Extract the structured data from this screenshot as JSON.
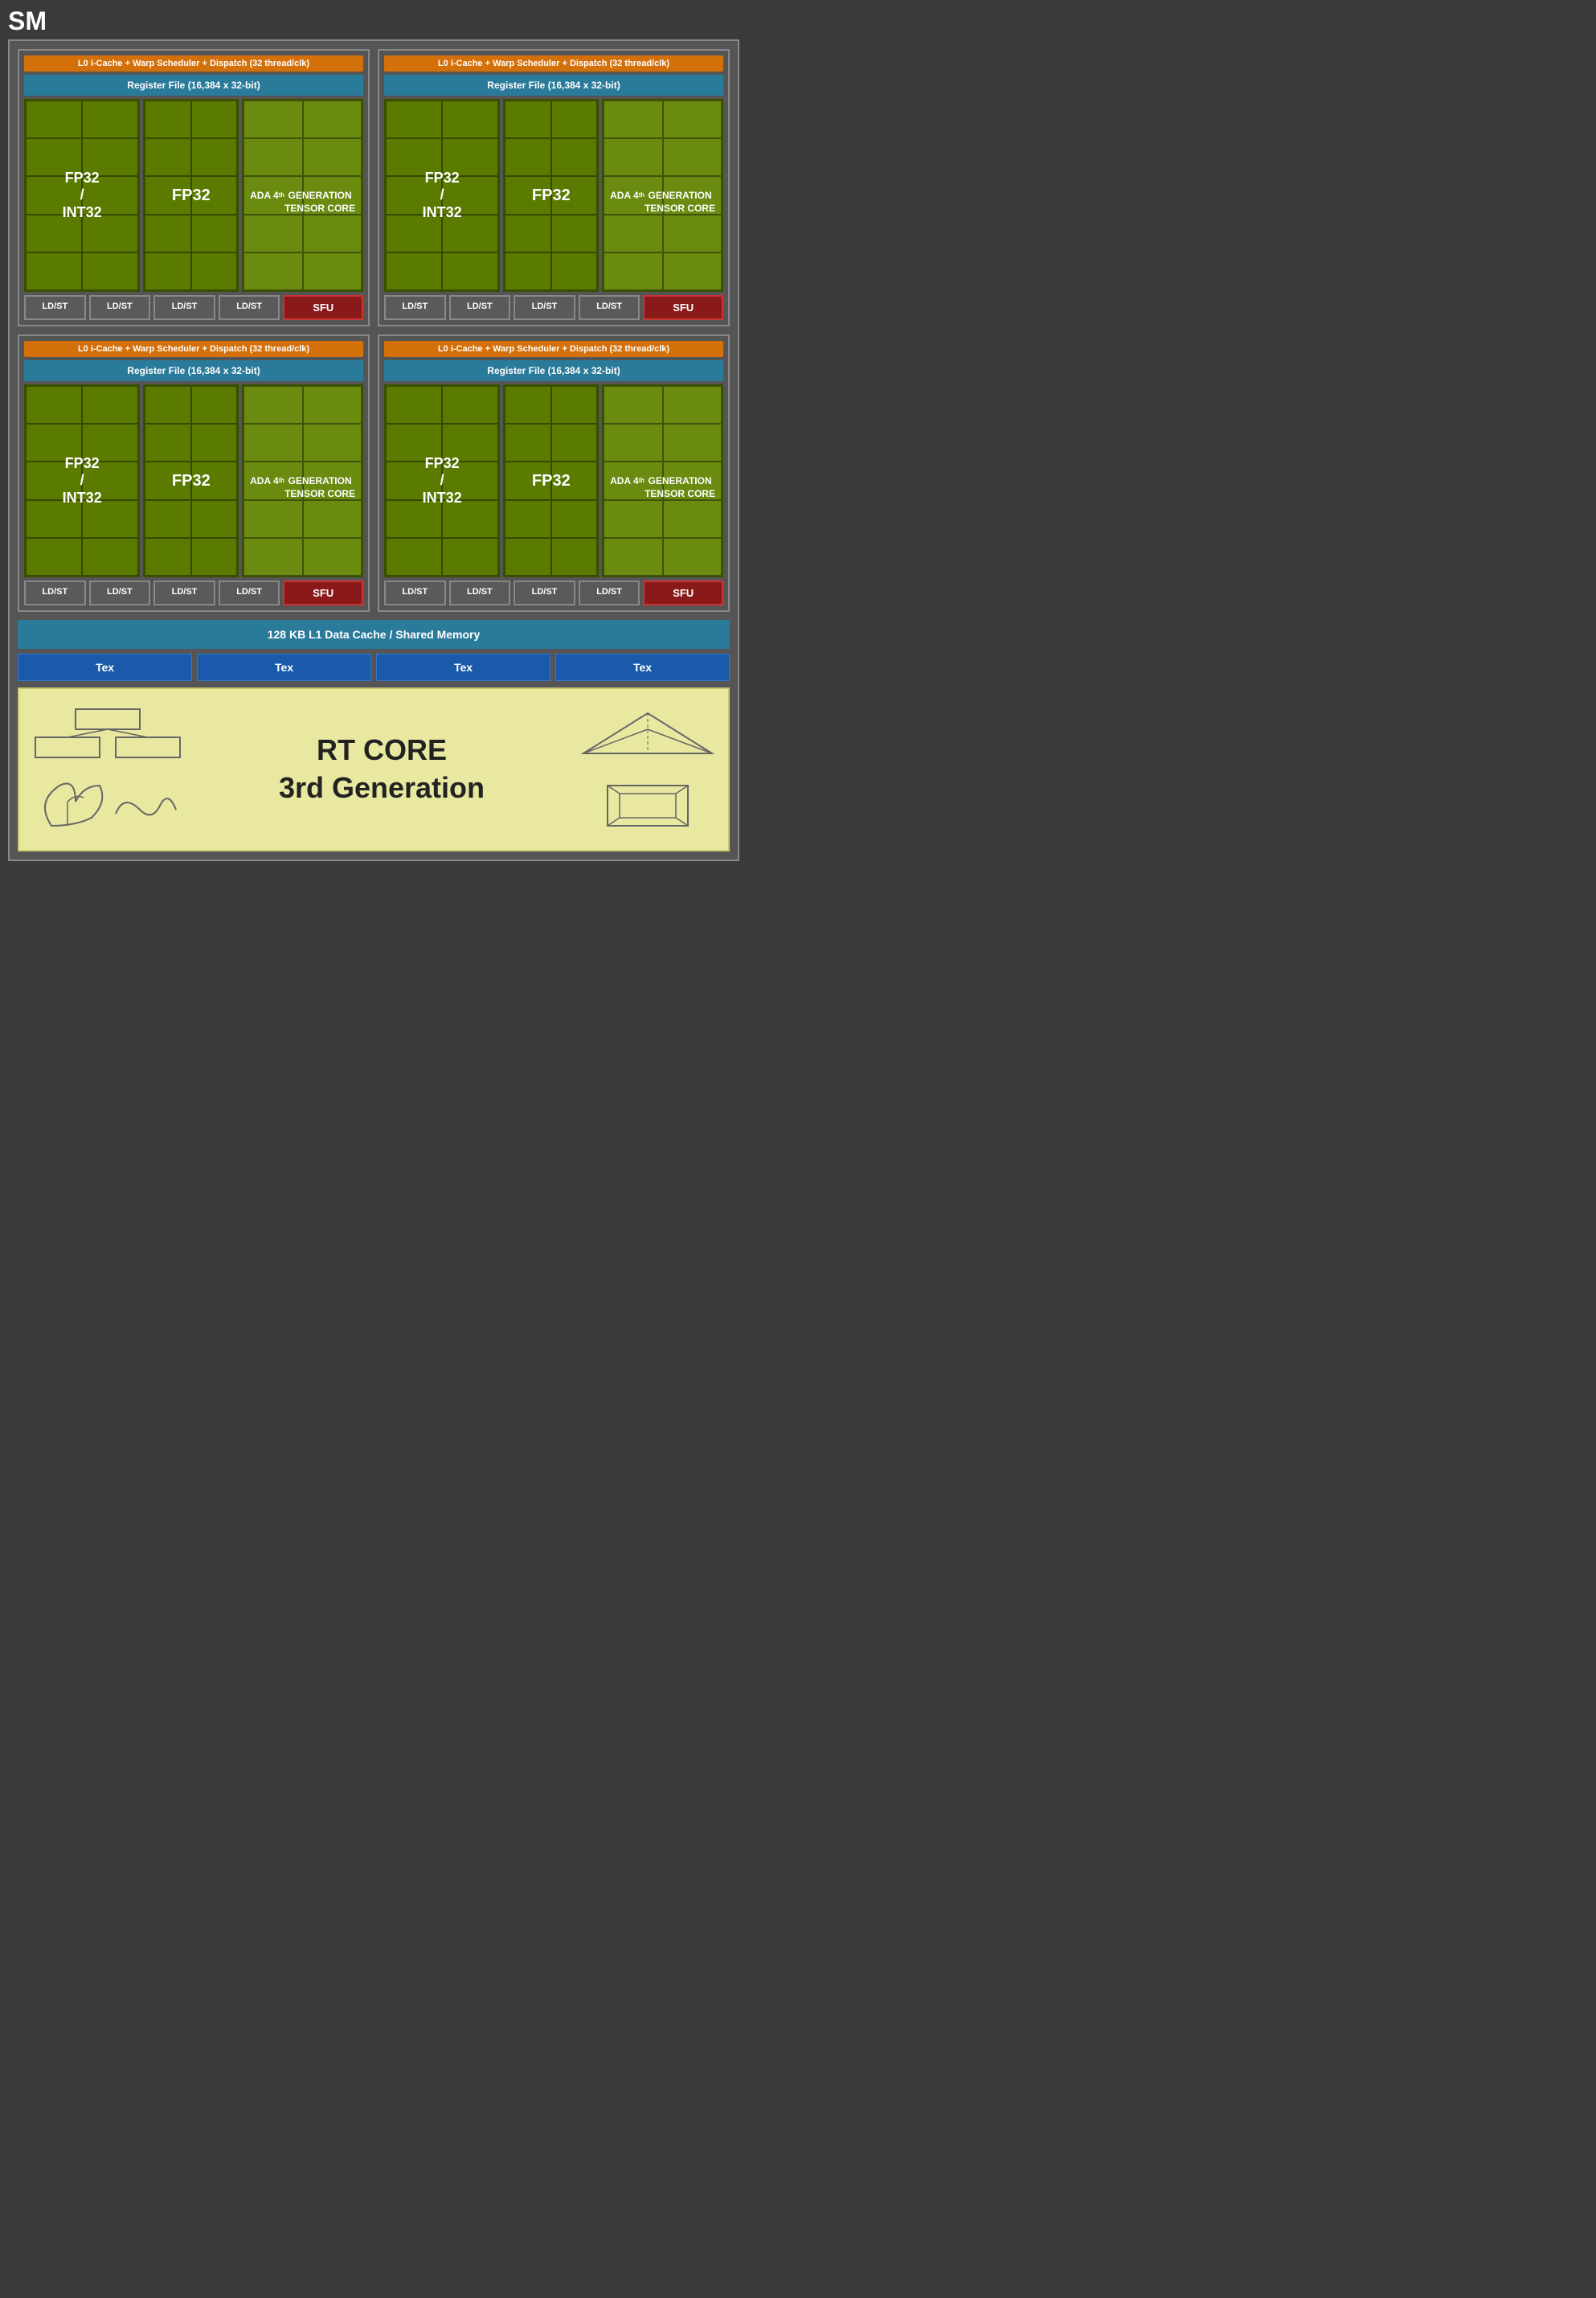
{
  "title": "SM",
  "quadrants": [
    {
      "id": "q1",
      "l0_header": "L0 i-Cache + Warp Scheduler + Dispatch (32 thread/clk)",
      "reg_file": "Register File (16,384 x 32-bit)",
      "fp32_int32_label": "FP32\n/\nINT32",
      "fp32_label": "FP32",
      "tensor_label": "ADA 4th\nGENERATION\nTENSOR CORE",
      "bottom": [
        "LD/ST",
        "LD/ST",
        "LD/ST",
        "LD/ST",
        "SFU"
      ]
    },
    {
      "id": "q2",
      "l0_header": "L0 i-Cache + Warp Scheduler + Dispatch (32 thread/clk)",
      "reg_file": "Register File (16,384 x 32-bit)",
      "fp32_int32_label": "FP32\n/\nINT32",
      "fp32_label": "FP32",
      "tensor_label": "ADA 4th\nGENERATION\nTENSOR CORE",
      "bottom": [
        "LD/ST",
        "LD/ST",
        "LD/ST",
        "LD/ST",
        "SFU"
      ]
    },
    {
      "id": "q3",
      "l0_header": "L0 i-Cache + Warp Scheduler + Dispatch (32 thread/clk)",
      "reg_file": "Register File (16,384 x 32-bit)",
      "fp32_int32_label": "FP32\n/\nINT32",
      "fp32_label": "FP32",
      "tensor_label": "ADA 4th\nGENERATION\nTENSOR CORE",
      "bottom": [
        "LD/ST",
        "LD/ST",
        "LD/ST",
        "LD/ST",
        "SFU"
      ]
    },
    {
      "id": "q4",
      "l0_header": "L0 i-Cache + Warp Scheduler + Dispatch (32 thread/clk)",
      "reg_file": "Register File (16,384 x 32-bit)",
      "fp32_int32_label": "FP32\n/\nINT32",
      "fp32_label": "FP32",
      "tensor_label": "ADA 4th\nGENERATION\nTENSOR CORE",
      "bottom": [
        "LD/ST",
        "LD/ST",
        "LD/ST",
        "LD/ST",
        "SFU"
      ]
    }
  ],
  "l1_cache": "128 KB L1 Data Cache / Shared Memory",
  "tex_units": [
    "Tex",
    "Tex",
    "Tex",
    "Tex"
  ],
  "rt_core_label": "RT CORE\n3rd Generation",
  "colors": {
    "orange": "#d4700a",
    "teal": "#2a7a9a",
    "dark_green": "#5a7a00",
    "medium_green": "#6a8a10",
    "dark_red": "#8a1a1a",
    "blue": "#1a5aaa",
    "rt_bg": "#e8e8a0"
  }
}
